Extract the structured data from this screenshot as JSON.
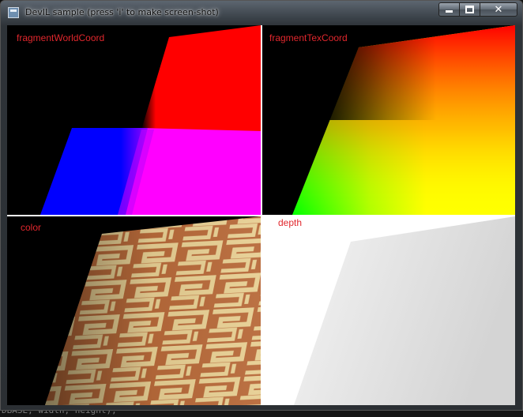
{
  "window": {
    "title": "DevIL sample (press 'i' to make screen-shot)",
    "icon": "app-window-icon",
    "controls": {
      "minimize": "minimize-icon",
      "maximize": "maximize-icon",
      "close": "close-icon"
    }
  },
  "panes": [
    {
      "label": "fragmentWorldCoord"
    },
    {
      "label": "fragmentTexCoord"
    },
    {
      "label": "color"
    },
    {
      "label": "depth"
    }
  ],
  "background_console": {
    "text": "DBASE, width, height);"
  },
  "colors": {
    "label": "#e1272d",
    "divider": "#ffffff",
    "viewport_background": "#000000"
  }
}
